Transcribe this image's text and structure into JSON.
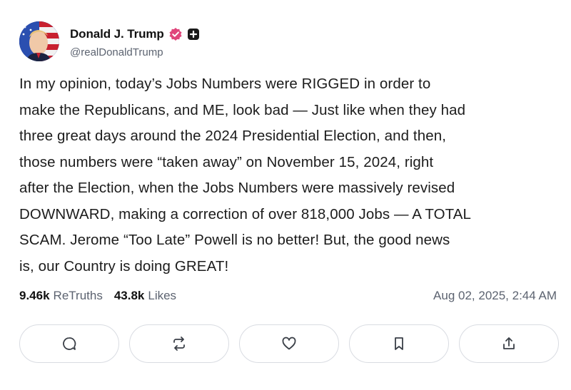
{
  "author": {
    "display_name": "Donald J. Trump",
    "handle": "@realDonaldTrump",
    "avatar_icon": "avatar-flag-portrait",
    "verified_icon": "verified-badge-icon",
    "verified_color": "#e0457b",
    "plus_icon": "plus-badge-icon"
  },
  "post": {
    "text": "In my opinion, today’s Jobs Numbers were RIGGED in order to\nmake the Republicans, and ME, look bad — Just like when they had\nthree great days around the 2024 Presidential Election, and then,\nthose numbers were “taken away” on November 15, 2024, right\nafter the Election, when the Jobs Numbers were massively revised\nDOWNWARD, making a correction of over 818,000 Jobs — A TOTAL\nSCAM. Jerome “Too Late” Powell is no better! But, the good news\nis, our Country is doing GREAT!",
    "retruths_count": "9.46k",
    "retruths_label": "ReTruths",
    "likes_count": "43.8k",
    "likes_label": "Likes",
    "timestamp": "Aug 02, 2025, 2:44 AM"
  },
  "actions": [
    {
      "name": "reply",
      "icon": "comment-icon"
    },
    {
      "name": "retruth",
      "icon": "repost-icon"
    },
    {
      "name": "like",
      "icon": "heart-icon"
    },
    {
      "name": "bookmark",
      "icon": "bookmark-icon"
    },
    {
      "name": "share",
      "icon": "share-icon"
    }
  ],
  "colors": {
    "text": "#1c1c1c",
    "muted": "#5c6370",
    "border": "#d9dce2"
  }
}
